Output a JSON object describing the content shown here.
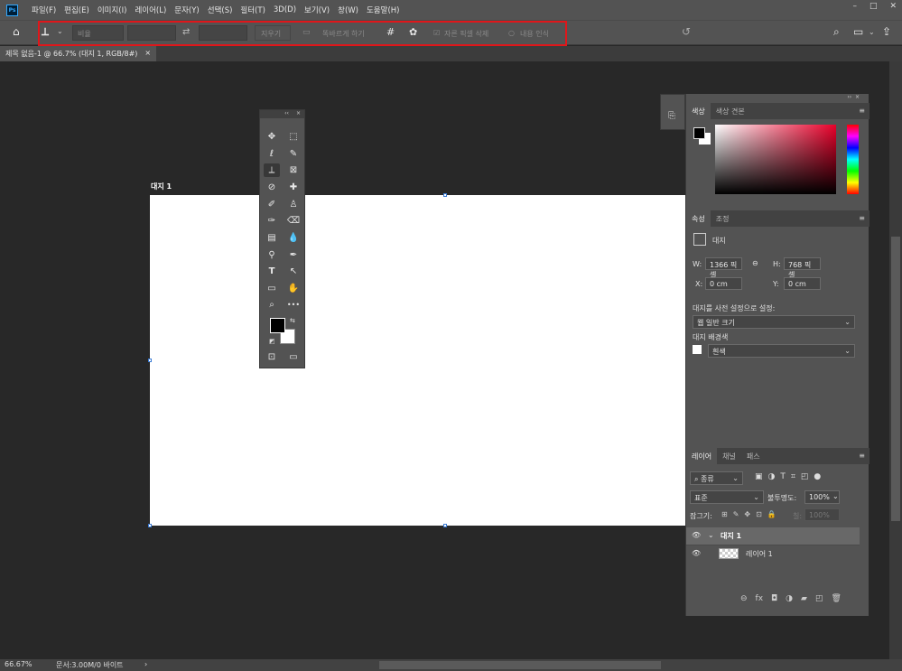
{
  "app": {
    "logo": "Ps"
  },
  "menu": [
    "파일(F)",
    "편집(E)",
    "이미지(I)",
    "레이어(L)",
    "문자(Y)",
    "선택(S)",
    "필터(T)",
    "3D(D)",
    "보기(V)",
    "창(W)",
    "도움말(H)"
  ],
  "window_controls": [
    "–",
    "□",
    "✕"
  ],
  "options": {
    "ratio_placeholder": "비율",
    "clear_label": "지우기",
    "straighten_label": "똑바르게 하기",
    "delete_cropped_label": "자른 픽셀 삭제",
    "content_aware_label": "내용 인식",
    "home_icon": "⌂",
    "crop_icon": "⟂",
    "swap_icon": "⇄",
    "grid_icon": "#",
    "gear_icon": "✿",
    "undo_icon": "↺",
    "search_icon": "⌕",
    "workspace_icon": "▭",
    "share_icon": "⇪"
  },
  "document": {
    "tab_title": "제목 없음-1 @ 66.7% (대지 1, RGB/8#)",
    "tab_close": "×",
    "artboard_label": "대지 1"
  },
  "toolbox": {
    "collapse": "‹‹",
    "close": "×",
    "tools": [
      "✥",
      "⬚",
      "ℓ",
      "✎",
      "⟂",
      "⊠",
      "⊘",
      "✚",
      "✐",
      "♙",
      "✑",
      "⌫",
      "▤",
      "💧",
      "⚲",
      "✒",
      "T",
      "↖",
      "▭",
      "✋",
      "⌕",
      "•••",
      "⊡",
      "▭"
    ]
  },
  "color_panel": {
    "tabs": [
      "색상",
      "색상 견본"
    ],
    "menu_icon": "≡",
    "collapse": "››",
    "close": "×"
  },
  "properties_panel": {
    "tabs": [
      "속성",
      "조정"
    ],
    "type_label": "대지",
    "w_label": "W:",
    "w_value": "1366 픽셀",
    "h_label": "H:",
    "h_value": "768 픽셀",
    "x_label": "X:",
    "x_value": "0 cm",
    "y_label": "Y:",
    "y_value": "0 cm",
    "preset_label": "대지를 사전 설정으로 설정:",
    "preset_value": "웹 일반 크기",
    "bg_label": "대지 배경색",
    "bg_value": "흰색"
  },
  "layers_panel": {
    "tabs": [
      "레이어",
      "채널",
      "패스"
    ],
    "filter_value": "종류",
    "blend_value": "표준",
    "opacity_label": "불투명도:",
    "opacity_value": "100%",
    "lock_label": "잠그기:",
    "fill_label": "칠:",
    "fill_value": "100%",
    "layers": [
      {
        "name": "대지 1",
        "type": "artboard"
      },
      {
        "name": "레이어 1",
        "type": "layer"
      }
    ],
    "footer_icons": [
      "⊖",
      "fx",
      "◘",
      "◑",
      "▰",
      "◰",
      "🗑"
    ]
  },
  "status": {
    "zoom": "66.67%",
    "doc_info": "문서:3.00M/0 바이트",
    "arrow": "›"
  }
}
